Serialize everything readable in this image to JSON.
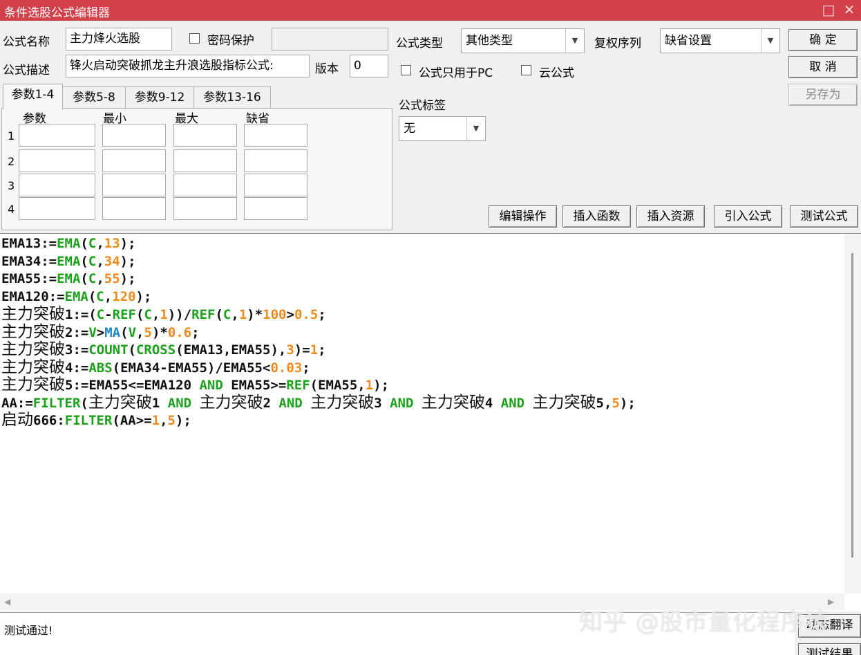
{
  "window": {
    "title": "条件选股公式编辑器",
    "maximize_icon": "□",
    "close_icon": "✕"
  },
  "header": {
    "name_label": "公式名称",
    "name_value": "主力烽火选股",
    "password_label": "密码保护",
    "desc_label": "公式描述",
    "desc_value": "锋火启动突破抓龙主升浪选股指标公式:",
    "version_label": "版本",
    "version_value": "0",
    "type_label": "公式类型",
    "type_value": "其他类型",
    "fq_label": "复权序列",
    "fq_value": "缺省设置",
    "pc_only_label": "公式只用于PC",
    "cloud_label": "云公式",
    "tag_label": "公式标签",
    "tag_value": "无"
  },
  "buttons": {
    "ok": "确 定",
    "cancel": "取 消",
    "save_as": "另存为",
    "edit_ops": "编辑操作",
    "insert_func": "插入函数",
    "insert_res": "插入资源",
    "import_formula": "引入公式",
    "test_formula": "测试公式",
    "dynamic_translate": "动态翻译",
    "test_result": "测试结果"
  },
  "params": {
    "tabs": [
      "参数1-4",
      "参数5-8",
      "参数9-12",
      "参数13-16"
    ],
    "columns": [
      "参数",
      "最小",
      "最大",
      "缺省"
    ],
    "rows": [
      "1",
      "2",
      "3",
      "4"
    ]
  },
  "code_colors": {
    "default": "#101010",
    "func": "#1ba11b",
    "num": "#f08a1c",
    "var": "#1e88c8"
  },
  "code_lines": [
    [
      [
        "EMA13:=",
        "d"
      ],
      [
        "EMA",
        "f"
      ],
      [
        "(",
        "d"
      ],
      [
        "C",
        "f"
      ],
      [
        ",",
        "d"
      ],
      [
        "13",
        "n"
      ],
      [
        ");",
        "d"
      ]
    ],
    [
      [
        "EMA34:=",
        "d"
      ],
      [
        "EMA",
        "f"
      ],
      [
        "(",
        "d"
      ],
      [
        "C",
        "f"
      ],
      [
        ",",
        "d"
      ],
      [
        "34",
        "n"
      ],
      [
        ");",
        "d"
      ]
    ],
    [
      [
        "EMA55:=",
        "d"
      ],
      [
        "EMA",
        "f"
      ],
      [
        "(",
        "d"
      ],
      [
        "C",
        "f"
      ],
      [
        ",",
        "d"
      ],
      [
        "55",
        "n"
      ],
      [
        ");",
        "d"
      ]
    ],
    [
      [
        "EMA120:=",
        "d"
      ],
      [
        "EMA",
        "f"
      ],
      [
        "(",
        "d"
      ],
      [
        "C",
        "f"
      ],
      [
        ",",
        "d"
      ],
      [
        "120",
        "n"
      ],
      [
        ");",
        "d"
      ]
    ],
    [
      [
        "主力突破",
        "c"
      ],
      [
        "1:=(",
        "d"
      ],
      [
        "C",
        "f"
      ],
      [
        "-",
        "d"
      ],
      [
        "REF",
        "f"
      ],
      [
        "(",
        "d"
      ],
      [
        "C",
        "f"
      ],
      [
        ",",
        "d"
      ],
      [
        "1",
        "n"
      ],
      [
        "))/",
        "d"
      ],
      [
        "REF",
        "f"
      ],
      [
        "(",
        "d"
      ],
      [
        "C",
        "f"
      ],
      [
        ",",
        "d"
      ],
      [
        "1",
        "n"
      ],
      [
        ")*",
        "d"
      ],
      [
        "100",
        "n"
      ],
      [
        ">",
        "d"
      ],
      [
        "0.5",
        "n"
      ],
      [
        ";",
        "d"
      ]
    ],
    [
      [
        "主力突破",
        "c"
      ],
      [
        "2:=",
        "d"
      ],
      [
        "V",
        "f"
      ],
      [
        ">",
        "d"
      ],
      [
        "MA",
        "v"
      ],
      [
        "(",
        "d"
      ],
      [
        "V",
        "f"
      ],
      [
        ",",
        "d"
      ],
      [
        "5",
        "n"
      ],
      [
        ")*",
        "d"
      ],
      [
        "0.6",
        "n"
      ],
      [
        ";",
        "d"
      ]
    ],
    [
      [
        "主力突破",
        "c"
      ],
      [
        "3:=",
        "d"
      ],
      [
        "COUNT",
        "f"
      ],
      [
        "(",
        "d"
      ],
      [
        "CROSS",
        "f"
      ],
      [
        "(EMA13,EMA55),",
        "d"
      ],
      [
        "3",
        "n"
      ],
      [
        ")=",
        "d"
      ],
      [
        "1",
        "n"
      ],
      [
        ";",
        "d"
      ]
    ],
    [
      [
        "主力突破",
        "c"
      ],
      [
        "4:=",
        "d"
      ],
      [
        "ABS",
        "f"
      ],
      [
        "(EMA34-EMA55)/EMA55<",
        "d"
      ],
      [
        "0.03",
        "n"
      ],
      [
        ";",
        "d"
      ]
    ],
    [
      [
        "主力突破",
        "c"
      ],
      [
        "5:=EMA55<=EMA120 ",
        "d"
      ],
      [
        "AND",
        "f"
      ],
      [
        " EMA55>=",
        "d"
      ],
      [
        "REF",
        "f"
      ],
      [
        "(EMA55,",
        "d"
      ],
      [
        "1",
        "n"
      ],
      [
        ");",
        "d"
      ]
    ],
    [
      [
        "AA:=",
        "d"
      ],
      [
        "FILTER",
        "f"
      ],
      [
        "(",
        "d"
      ],
      [
        "主力突破",
        "c"
      ],
      [
        "1 ",
        "d"
      ],
      [
        "AND",
        "f"
      ],
      [
        " ",
        "d"
      ],
      [
        "主力突破",
        "c"
      ],
      [
        "2 ",
        "d"
      ],
      [
        "AND",
        "f"
      ],
      [
        " ",
        "d"
      ],
      [
        "主力突破",
        "c"
      ],
      [
        "3 ",
        "d"
      ],
      [
        "AND",
        "f"
      ],
      [
        " ",
        "d"
      ],
      [
        "主力突破",
        "c"
      ],
      [
        "4 ",
        "d"
      ],
      [
        "AND",
        "f"
      ],
      [
        " ",
        "d"
      ],
      [
        "主力突破",
        "c"
      ],
      [
        "5,",
        "d"
      ],
      [
        "5",
        "n"
      ],
      [
        ");",
        "d"
      ]
    ],
    [
      [
        "启动",
        "c"
      ],
      [
        "666:",
        "d"
      ],
      [
        "FILTER",
        "f"
      ],
      [
        "(AA>=",
        "d"
      ],
      [
        "1",
        "n"
      ],
      [
        ",",
        "d"
      ],
      [
        "5",
        "n"
      ],
      [
        ");",
        "d"
      ]
    ]
  ],
  "status": {
    "message": "测试通过!"
  },
  "watermark": "知乎 @股市量化程序猿"
}
